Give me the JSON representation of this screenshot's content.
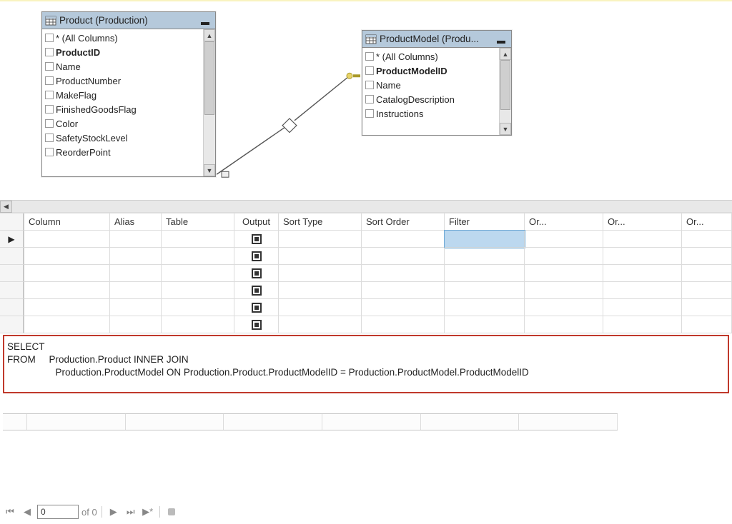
{
  "tables": {
    "product": {
      "title": "Product (Production)",
      "columns": [
        {
          "label": "* (All Columns)",
          "bold": false
        },
        {
          "label": "ProductID",
          "bold": true
        },
        {
          "label": "Name",
          "bold": false
        },
        {
          "label": "ProductNumber",
          "bold": false
        },
        {
          "label": "MakeFlag",
          "bold": false
        },
        {
          "label": "FinishedGoodsFlag",
          "bold": false
        },
        {
          "label": "Color",
          "bold": false
        },
        {
          "label": "SafetyStockLevel",
          "bold": false
        },
        {
          "label": "ReorderPoint",
          "bold": false
        }
      ]
    },
    "productmodel": {
      "title": "ProductModel (Produ...",
      "columns": [
        {
          "label": "* (All Columns)",
          "bold": false
        },
        {
          "label": "ProductModelID",
          "bold": true
        },
        {
          "label": "Name",
          "bold": false
        },
        {
          "label": "CatalogDescription",
          "bold": false
        },
        {
          "label": "Instructions",
          "bold": false
        }
      ]
    }
  },
  "criteria": {
    "headers": {
      "column": "Column",
      "alias": "Alias",
      "table": "Table",
      "output": "Output",
      "sorttype": "Sort Type",
      "sortorder": "Sort Order",
      "filter": "Filter",
      "or1": "Or...",
      "or2": "Or...",
      "or3": "Or..."
    }
  },
  "sql": {
    "line1": "SELECT",
    "line2": "FROM     Production.Product INNER JOIN",
    "line3": "                  Production.ProductModel ON Production.Product.ProductModelID = Production.ProductModel.ProductModelID"
  },
  "nav": {
    "pos": "0",
    "of": "of 0"
  }
}
